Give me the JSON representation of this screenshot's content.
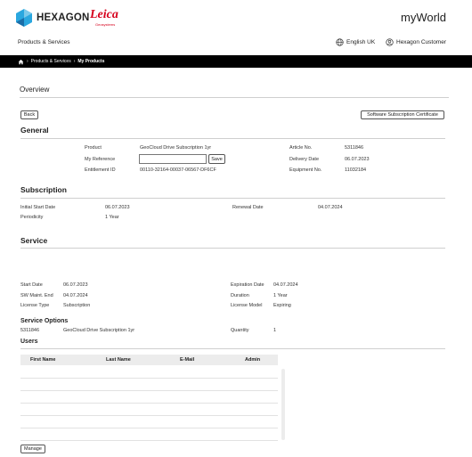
{
  "header": {
    "brand_hexagon": "HEXAGON",
    "brand_leica": "Leica",
    "brand_leica_sub": "Geosystems",
    "app_title": "myWorld",
    "products_services": "Products & Services",
    "language": "English UK",
    "user": "Hexagon Customer"
  },
  "breadcrumb": {
    "items": [
      "Products & Services",
      "My Products"
    ]
  },
  "page": {
    "title": "Overview",
    "back_label": "Back",
    "certificate_label": "Software Subscription Certificate"
  },
  "general": {
    "heading": "General",
    "product_label": "Product",
    "product_value": "GeoCloud Drive Subscription 1yr",
    "reference_label": "My Reference",
    "reference_value": "",
    "save_label": "Save",
    "entitlement_label": "Entitlement ID",
    "entitlement_value": "00110-32164-00037-06567-DF6CF",
    "article_label": "Article No.",
    "article_value": "5311846",
    "delivery_label": "Delivery Date",
    "delivery_value": "06.07.2023",
    "equipment_label": "Equipment No.",
    "equipment_value": "11032184"
  },
  "subscription": {
    "heading": "Subscription",
    "initial_start_label": "Initial Start Date",
    "initial_start_value": "06.07.2023",
    "periodicity_label": "Periodicity",
    "periodicity_value": "1 Year",
    "renewal_label": "Renewal Date",
    "renewal_value": "04.07.2024"
  },
  "service": {
    "heading": "Service",
    "start_label": "Start Date",
    "start_value": "06.07.2023",
    "sw_maint_label": "SW Maint. End",
    "sw_maint_value": "04.07.2024",
    "license_type_label": "License Type",
    "license_type_value": "Subscription",
    "expiration_label": "Expiration Date",
    "expiration_value": "04.07.2024",
    "duration_label": "Duration",
    "duration_value": "1 Year",
    "license_model_label": "License Model",
    "license_model_value": "Expiring"
  },
  "service_options": {
    "heading": "Service Options",
    "article": "5311846",
    "description": "GeoCloud Drive Subscription 1yr",
    "quantity_label": "Quantity",
    "quantity_value": "1"
  },
  "users": {
    "heading": "Users",
    "columns": [
      "First Name",
      "Last Name",
      "E-Mail",
      "Admin"
    ],
    "manage_label": "Manage"
  },
  "colors": {
    "navbar": "#000000",
    "hexagon_blue": "#2aa7df",
    "leica_red": "#d6001c"
  }
}
